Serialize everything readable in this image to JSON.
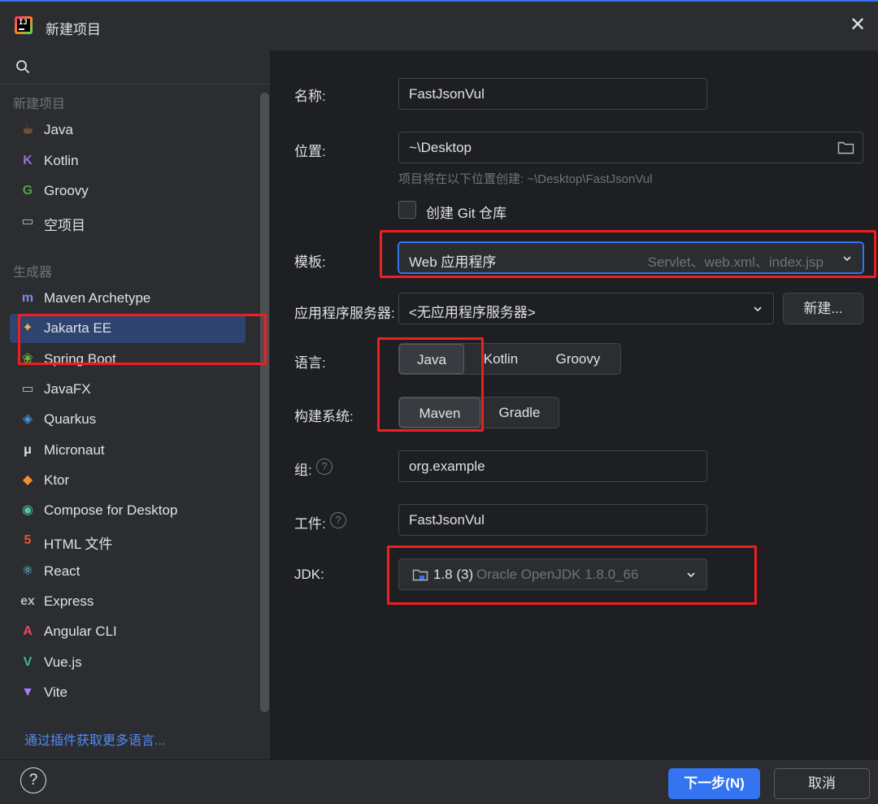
{
  "window": {
    "title": "新建项目"
  },
  "sidebar": {
    "section_new": "新建项目",
    "new_items": [
      {
        "label": "Java",
        "icon": "java-icon",
        "color": "#e0893e"
      },
      {
        "label": "Kotlin",
        "icon": "kotlin-icon",
        "color": "#9a6cdc"
      },
      {
        "label": "Groovy",
        "icon": "groovy-icon",
        "color": "#4fa34f"
      },
      {
        "label": "空项目",
        "icon": "empty-project-icon",
        "color": "#b6b9bf"
      }
    ],
    "section_generators": "生成器",
    "generator_items": [
      {
        "label": "Maven Archetype",
        "icon": "maven-icon",
        "color": "#7a89e8"
      },
      {
        "label": "Jakarta EE",
        "icon": "jakarta-icon",
        "color": "#f3b33d"
      },
      {
        "label": "Spring Boot",
        "icon": "spring-icon",
        "color": "#6cb33e"
      },
      {
        "label": "JavaFX",
        "icon": "javafx-icon",
        "color": "#b6b9bf"
      },
      {
        "label": "Quarkus",
        "icon": "quarkus-icon",
        "color": "#4695eb"
      },
      {
        "label": "Micronaut",
        "icon": "micronaut-icon",
        "color": "#dfe1e5"
      },
      {
        "label": "Ktor",
        "icon": "ktor-icon",
        "color": "#f28c30"
      },
      {
        "label": "Compose for Desktop",
        "icon": "compose-icon",
        "color": "#4dc7a3"
      },
      {
        "label": "HTML 文件",
        "icon": "html-icon",
        "color": "#e4572e"
      },
      {
        "label": "React",
        "icon": "react-icon",
        "color": "#61dafb"
      },
      {
        "label": "Express",
        "icon": "express-icon",
        "color": "#b6b9bf"
      },
      {
        "label": "Angular CLI",
        "icon": "angular-icon",
        "color": "#e04c66"
      },
      {
        "label": "Vue.js",
        "icon": "vue-icon",
        "color": "#41b883"
      },
      {
        "label": "Vite",
        "icon": "vite-icon",
        "color": "#a67dff"
      }
    ],
    "selected": "Jakarta EE",
    "more_link": "通过插件获取更多语言..."
  },
  "form": {
    "name_label": "名称:",
    "name_value": "FastJsonVul",
    "location_label": "位置:",
    "location_value": "~\\Desktop",
    "location_hint": "项目将在以下位置创建: ~\\Desktop\\FastJsonVul",
    "git_label": "创建 Git 仓库",
    "git_checked": false,
    "template_label": "模板:",
    "template_value": "Web 应用程序",
    "template_sub": "Servlet、web.xml、index.jsp",
    "server_label": "应用程序服务器:",
    "server_value": "<无应用程序服务器>",
    "server_new_button": "新建...",
    "language_label": "语言:",
    "languages": [
      "Java",
      "Kotlin",
      "Groovy"
    ],
    "language_selected": "Java",
    "build_label": "构建系统:",
    "build_systems": [
      "Maven",
      "Gradle"
    ],
    "build_selected": "Maven",
    "group_label": "组:",
    "group_value": "org.example",
    "artifact_label": "工件:",
    "artifact_value": "FastJsonVul",
    "jdk_label": "JDK:",
    "jdk_version": "1.8 (3)",
    "jdk_name": "Oracle OpenJDK 1.8.0_66"
  },
  "footer": {
    "help": "?",
    "next_button": "下一步(N)",
    "cancel_button": "取消"
  },
  "colors": {
    "accent": "#3574f0",
    "highlight": "#ef1f1f",
    "selection": "#2e436e"
  }
}
